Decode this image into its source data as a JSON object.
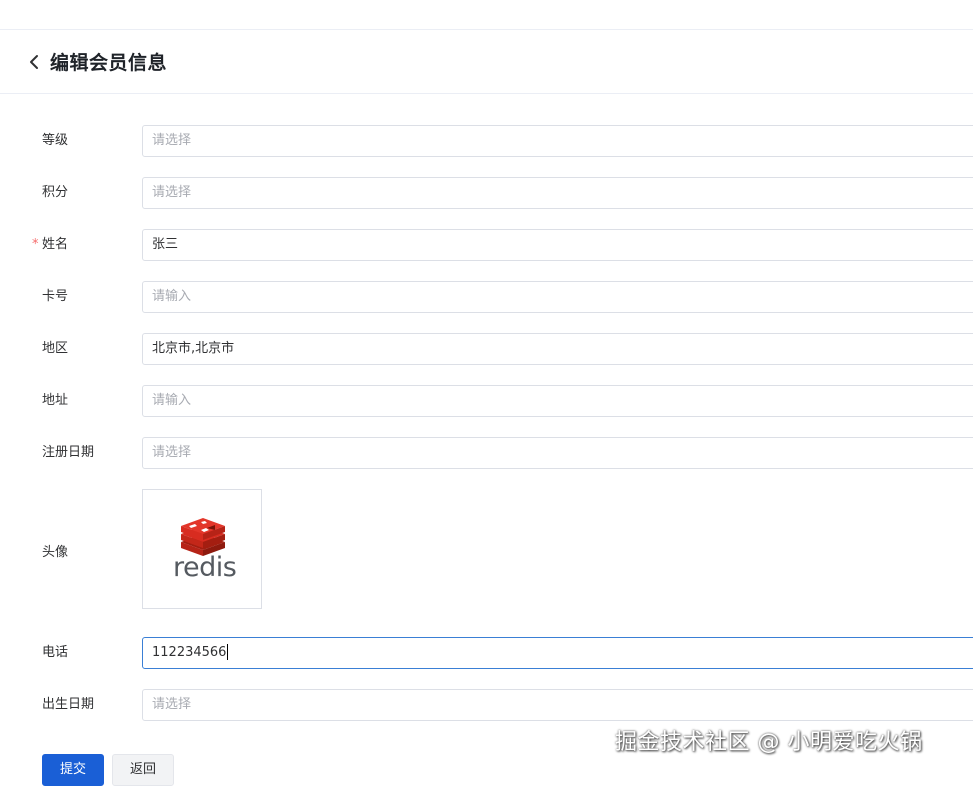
{
  "header": {
    "title": "编辑会员信息"
  },
  "form": {
    "fields": [
      {
        "label": "等级",
        "value": "",
        "placeholder": "请选择",
        "required": false
      },
      {
        "label": "积分",
        "value": "",
        "placeholder": "请选择",
        "required": false
      },
      {
        "label": "姓名",
        "value": "张三",
        "placeholder": "",
        "required": true
      },
      {
        "label": "卡号",
        "value": "",
        "placeholder": "请输入",
        "required": false
      },
      {
        "label": "地区",
        "value": "北京市,北京市",
        "placeholder": "",
        "required": false
      },
      {
        "label": "地址",
        "value": "",
        "placeholder": "请输入",
        "required": false
      },
      {
        "label": "注册日期",
        "value": "",
        "placeholder": "请选择",
        "required": false
      }
    ],
    "avatar": {
      "label": "头像",
      "image_text": "redis",
      "brand_color": "#d82c20"
    },
    "phone": {
      "label": "电话",
      "value": "112234566"
    },
    "birthday": {
      "label": "出生日期",
      "value": "",
      "placeholder": "请选择"
    },
    "required_mark": "*"
  },
  "actions": {
    "submit_label": "提交",
    "back_label": "返回"
  },
  "watermark": "掘金技术社区 @ 小明爱吃火锅",
  "colors": {
    "primary": "#1a5fd6",
    "required": "#f56c6c",
    "border": "#dcdfe6"
  }
}
